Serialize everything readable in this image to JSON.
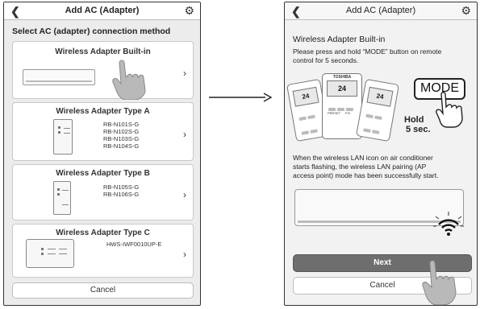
{
  "left_screen": {
    "title": "Add AC (Adapter)",
    "section_title": "Select AC (adapter) connection method",
    "cards": [
      {
        "title": "Wireless Adapter Built-in",
        "models": []
      },
      {
        "title": "Wireless Adapter Type A",
        "models": [
          "RB-N101S-G",
          "RB-N102S-G",
          "RB-N103S-G",
          "RB-N104S-G"
        ]
      },
      {
        "title": "Wireless Adapter Type B",
        "models": [
          "RB-N105S-G",
          "RB-N106S-G"
        ]
      },
      {
        "title": "Wireless Adapter Type C",
        "models": [
          "HWS-IWF0010UP-E"
        ]
      }
    ],
    "cancel_label": "Cancel"
  },
  "right_screen": {
    "title": "Add AC (Adapter)",
    "heading": "Wireless Adapter Built-in",
    "instruction_lines": [
      "Please press and hold “MODE” button on remote",
      "control for 5 seconds."
    ],
    "remote_brand": "TOSHIBA",
    "remote_display": "24",
    "remote_key_preset": "PRESET",
    "remote_key_fix": "FIX",
    "mode_label": "MODE",
    "hold_lines": [
      "Hold",
      "5 sec."
    ],
    "result_lines": [
      "When the wireless LAN icon on air conditioner",
      "starts flashing, the wireless LAN pairing (AP",
      "access point) mode has been successfully start."
    ],
    "next_label": "Next",
    "cancel_label": "Cancel"
  },
  "icons": {
    "back": "chevron-left-icon",
    "settings": "gear-icon",
    "card_arrow": "chevron-right-icon",
    "flow_arrow": "arrow-right-icon",
    "wifi": "wifi-icon",
    "pointer": "pointing-hand-icon"
  },
  "colors": {
    "next_button": "#6e6e6e",
    "screen_background": "#ececec"
  }
}
